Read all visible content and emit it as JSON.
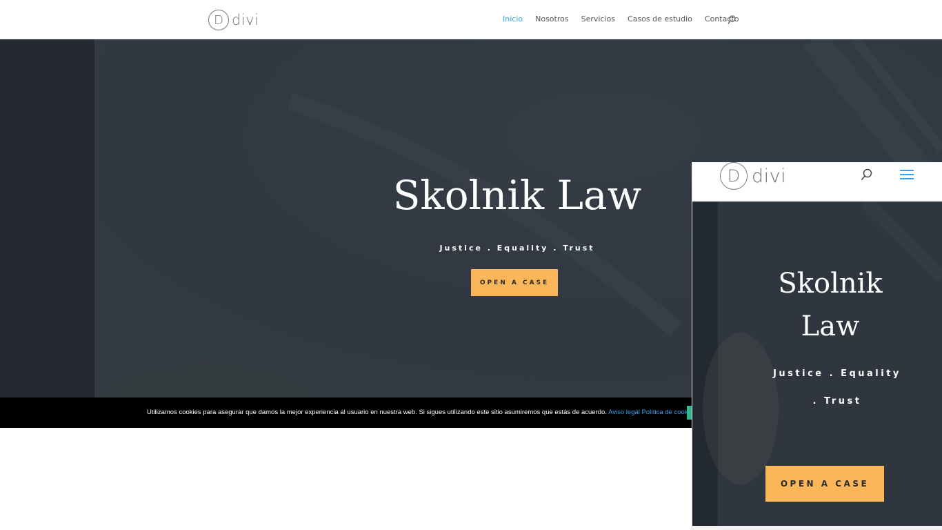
{
  "header": {
    "logo_letter": "D",
    "logo_text": "divi",
    "nav": [
      {
        "label": "Inicio",
        "active": true
      },
      {
        "label": "Nosotros",
        "active": false
      },
      {
        "label": "Servicios",
        "active": false
      },
      {
        "label": "Casos de estudio",
        "active": false
      },
      {
        "label": "Contacto",
        "active": false
      }
    ],
    "search_icon": "search-icon"
  },
  "hero": {
    "title": "Skolnik Law",
    "tagline": "Justice . Equality . Trust",
    "cta_label": "OPEN A CASE"
  },
  "cookie_bar": {
    "message": "Utilizamos cookies para asegurar que damos la mejor experiencia al usuario en nuestra web. Si sigues utilizando este sitio asumiremos que estás de acuerdo.",
    "link_legal": "Aviso legal",
    "link_policy": "Política de cookies"
  },
  "mobile_preview": {
    "logo_letter": "D",
    "logo_text": "divi",
    "title_line1": "Skolnik",
    "title_line2": "Law",
    "tagline_line1": "Justice . Equality",
    "tagline_line2": ". Trust",
    "cta_label": "OPEN A CASE",
    "menu_icon": "hamburger-menu-icon"
  },
  "colors": {
    "accent": "#2ea3f2",
    "button": "#fcb65a",
    "hero_bg": "#323943",
    "cookie_bg": "#000000",
    "cookie_accept": "#35b58e"
  }
}
